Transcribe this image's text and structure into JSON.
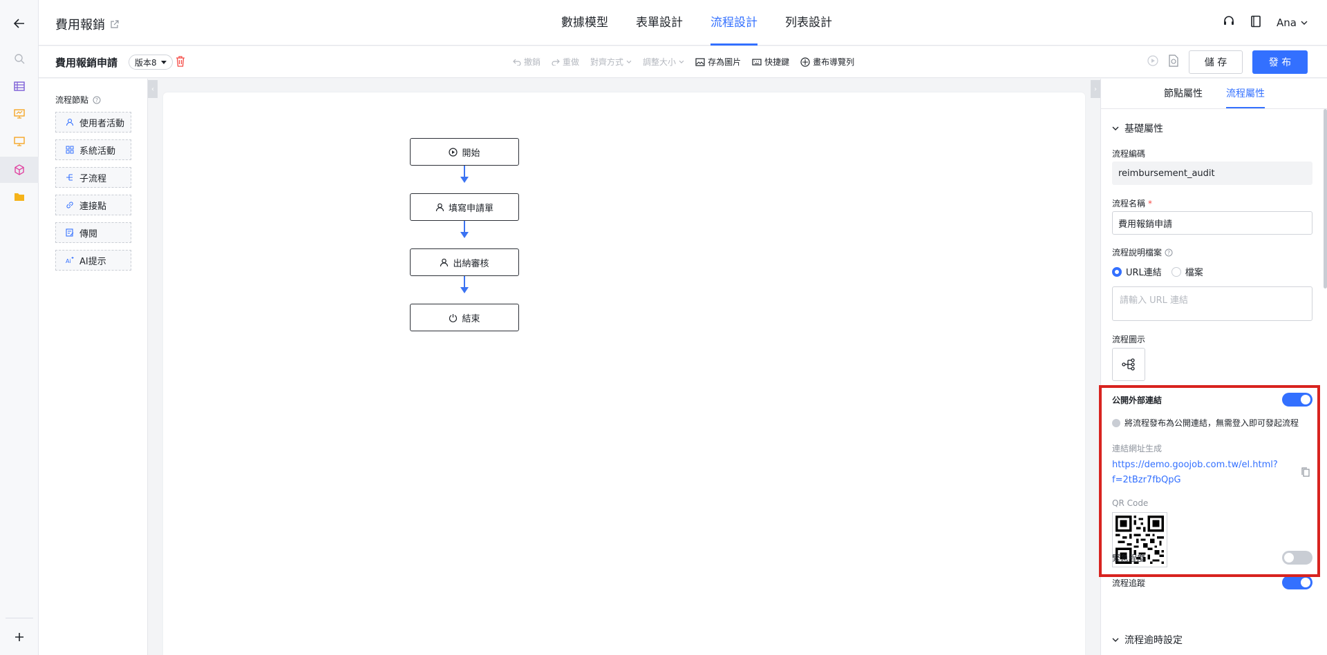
{
  "header": {
    "app_title": "費用報銷",
    "tabs": [
      "數據模型",
      "表單設計",
      "流程設計",
      "列表設計"
    ],
    "active_tab": 2,
    "user": "Ana"
  },
  "toolbar": {
    "process_name": "費用報銷申請",
    "version": "版本8",
    "undo": "撤銷",
    "redo": "重做",
    "align": "對齊方式",
    "resize": "調整大小",
    "save_image": "存為圖片",
    "shortcut": "快捷鍵",
    "canvas_nav": "畫布導覽列",
    "save_label": "儲 存",
    "publish_label": "發 布"
  },
  "palette": {
    "title": "流程節點",
    "items": [
      {
        "label": "使用者活動",
        "icon": "user-icon"
      },
      {
        "label": "系統活動",
        "icon": "grid-icon"
      },
      {
        "label": "子流程",
        "icon": "subflow-icon"
      },
      {
        "label": "連接點",
        "icon": "link-icon"
      },
      {
        "label": "傳閱",
        "icon": "circulate-icon"
      },
      {
        "label": "AI提示",
        "icon": "ai-icon"
      }
    ]
  },
  "flow": {
    "nodes": [
      {
        "label": "開始",
        "icon": "play-icon"
      },
      {
        "label": "填寫申請單",
        "icon": "user-icon"
      },
      {
        "label": "出納審核",
        "icon": "user-icon"
      },
      {
        "label": "結束",
        "icon": "power-icon"
      }
    ]
  },
  "panel": {
    "tabs": [
      "節點屬性",
      "流程屬性"
    ],
    "active_tab": 1,
    "section_basic": "基礎屬性",
    "code_label": "流程編碼",
    "code_value": "reimbursement_audit",
    "name_label": "流程名稱",
    "name_required": "*",
    "name_value": "費用報銷申請",
    "doc_label": "流程說明檔案",
    "doc_option_url": "URL連結",
    "doc_option_file": "檔案",
    "url_placeholder": "請輸入 URL 連結",
    "icon_label": "流程圖示",
    "public_link_label": "公開外部連結",
    "public_link_on": true,
    "public_link_hint": "將流程發布為公開連結，無需登入即可發起流程",
    "url_gen_label": "連結網址生成",
    "url_value": "https://demo.goojob.com.tw/el.html?f=2tBzr7fbQpG",
    "qr_label": "QR Code",
    "urgency_label": "緊急程度",
    "urgency_on": false,
    "tracking_label": "流程追蹤",
    "tracking_on": true,
    "section_timeout": "流程逾時設定"
  },
  "colors": {
    "accent": "#3370ff",
    "highlight": "#d8231f",
    "edge": "#3b73f2"
  }
}
